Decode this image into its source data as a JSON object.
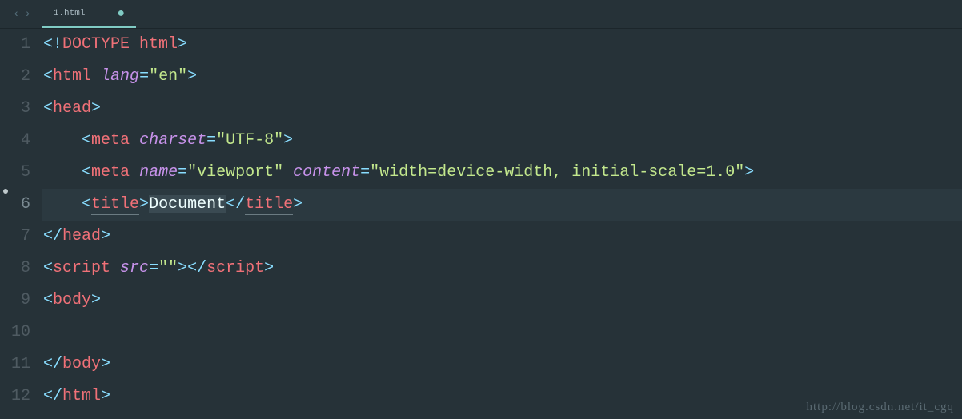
{
  "tab": {
    "filename": "1.html",
    "dirty": "●"
  },
  "nav": {
    "back": "‹",
    "forward": "›"
  },
  "gutter": [
    "1",
    "2",
    "3",
    "4",
    "5",
    "6",
    "7",
    "8",
    "9",
    "10",
    "11",
    "12"
  ],
  "active_line": 6,
  "code": {
    "l1": {
      "open": "<!",
      "doctype": "DOCTYPE html",
      "close": ">"
    },
    "l2": {
      "open": "<",
      "tag": "html",
      "sp": " ",
      "attr": "lang",
      "eq": "=",
      "val": "\"en\"",
      "close": ">"
    },
    "l3": {
      "open": "<",
      "tag": "head",
      "close": ">"
    },
    "l4": {
      "indent": "    ",
      "open": "<",
      "tag": "meta",
      "sp": " ",
      "attr": "charset",
      "eq": "=",
      "val": "\"UTF-8\"",
      "close": ">"
    },
    "l5": {
      "indent": "    ",
      "open": "<",
      "tag": "meta",
      "sp": " ",
      "attr1": "name",
      "eq1": "=",
      "val1": "\"viewport\"",
      "sp2": " ",
      "attr2": "content",
      "eq2": "=",
      "val2": "\"width=device-width, initial-scale=1.0\"",
      "close": ">"
    },
    "l6": {
      "indent": "    ",
      "open": "<",
      "tag": "title",
      "close1": ">",
      "text": "Document",
      "open2": "</",
      "close2": ">"
    },
    "l7": {
      "open": "</",
      "tag": "head",
      "close": ">"
    },
    "l8": {
      "open": "<",
      "tag": "script",
      "sp": " ",
      "attr": "src",
      "eq": "=",
      "val": "\"\"",
      "close1": ">",
      "open2": "</",
      "close2": ">"
    },
    "l9": {
      "open": "<",
      "tag": "body",
      "close": ">"
    },
    "l11": {
      "open": "</",
      "tag": "body",
      "close": ">"
    },
    "l12": {
      "open": "</",
      "tag": "html",
      "close": ">"
    }
  },
  "watermark": "http://blog.csdn.net/it_cgq"
}
